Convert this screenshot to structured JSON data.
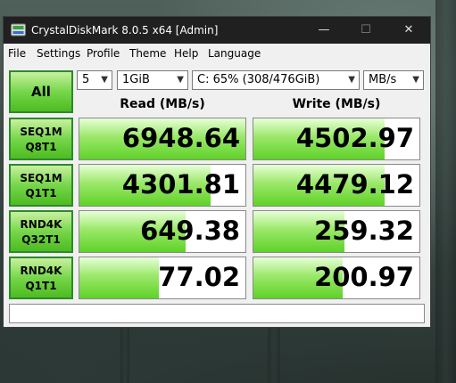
{
  "window": {
    "title": "CrystalDiskMark 8.0.5 x64 [Admin]",
    "controls": {
      "minimize": "—",
      "maximize": "☐",
      "close": "✕"
    }
  },
  "menu": [
    "File",
    "Settings",
    "Profile",
    "Theme",
    "Help",
    "Language"
  ],
  "controls": {
    "all_label": "All",
    "runs": "5",
    "size": "1GiB",
    "drive": "C: 65% (308/476GiB)",
    "unit": "MB/s"
  },
  "columns": {
    "read": "Read (MB/s)",
    "write": "Write (MB/s)"
  },
  "tests": [
    {
      "line1": "SEQ1M",
      "line2": "Q8T1",
      "read": "6948.64",
      "write": "4502.97",
      "read_fill": 1.0,
      "write_fill": 0.79
    },
    {
      "line1": "SEQ1M",
      "line2": "Q1T1",
      "read": "4301.81",
      "write": "4479.12",
      "read_fill": 0.79,
      "write_fill": 0.79
    },
    {
      "line1": "RND4K",
      "line2": "Q32T1",
      "read": "649.38",
      "write": "259.32",
      "read_fill": 0.64,
      "write_fill": 0.55
    },
    {
      "line1": "RND4K",
      "line2": "Q1T1",
      "read": "77.02",
      "write": "200.97",
      "read_fill": 0.48,
      "write_fill": 0.54
    }
  ],
  "comment": "",
  "colors": {
    "accent_green": "#5fd228",
    "button_border": "#2b8a2b",
    "titlebar": "#202020"
  },
  "icons": {
    "app": "crystaldiskmark-drive-icon",
    "dropdown": "chevron-down-icon"
  }
}
